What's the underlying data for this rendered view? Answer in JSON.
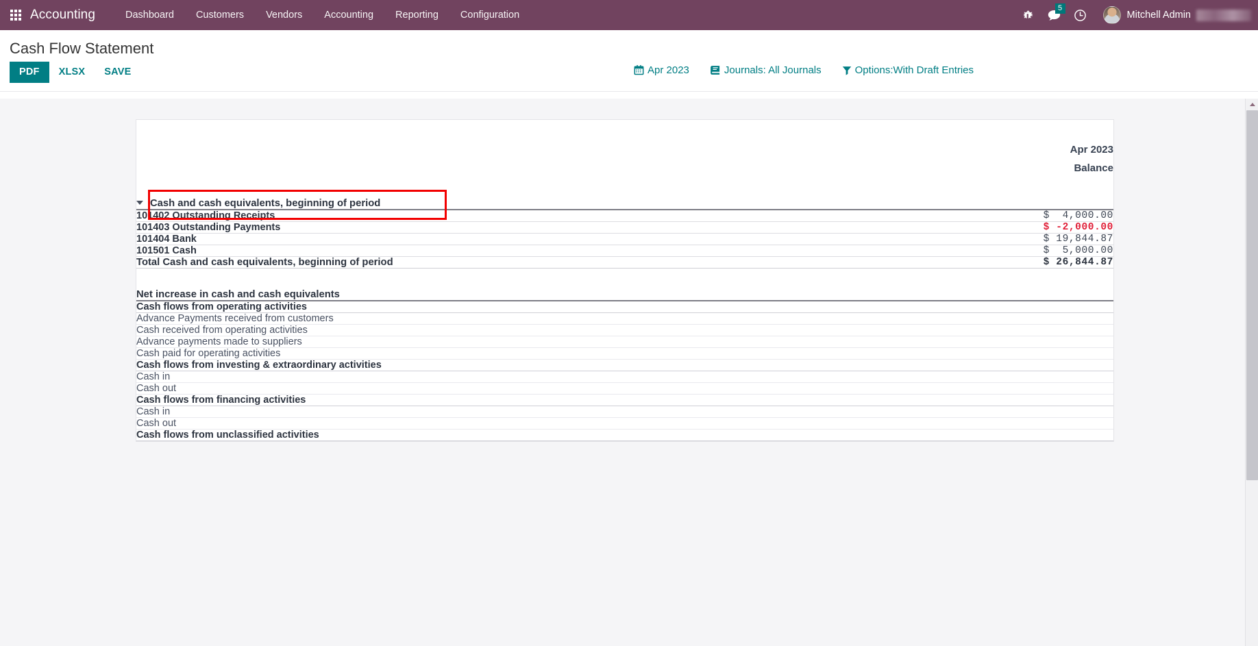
{
  "navbar": {
    "apps_icon": "apps-grid-icon",
    "brand": "Accounting",
    "menu": [
      {
        "label": "Dashboard"
      },
      {
        "label": "Customers"
      },
      {
        "label": "Vendors"
      },
      {
        "label": "Accounting"
      },
      {
        "label": "Reporting"
      },
      {
        "label": "Configuration"
      }
    ],
    "icons": [
      {
        "name": "bug-icon"
      },
      {
        "name": "messages-icon",
        "badge": "5"
      },
      {
        "name": "activities-clock-icon"
      }
    ],
    "user": {
      "name": "Mitchell Admin"
    },
    "accent_color": "#71435F",
    "badge_color": "#00787A"
  },
  "control_panel": {
    "title": "Cash Flow Statement",
    "buttons": [
      {
        "name": "pdf",
        "label": "PDF",
        "style": "primary"
      },
      {
        "name": "xlsx",
        "label": "XLSX",
        "style": "link"
      },
      {
        "name": "save",
        "label": "SAVE",
        "style": "link"
      }
    ],
    "filters": [
      {
        "name": "date-filter",
        "icon": "calendar-icon",
        "label": "Apr 2023"
      },
      {
        "name": "journals-filter",
        "icon": "book-icon",
        "label": "Journals: All Journals"
      },
      {
        "name": "options-filter",
        "icon": "funnel-icon",
        "label": "Options:With Draft Entries"
      }
    ],
    "accent_color": "#017e84"
  },
  "report": {
    "column_header": {
      "period": "Apr 2023",
      "measure": "Balance"
    },
    "highlight_color": "#f20000",
    "negative_color": "#e01e37",
    "rows": [
      {
        "id": "cash-begin",
        "label": "Cash and cash equivalents, beginning of period",
        "value": "",
        "level": 0,
        "type": "section",
        "caret": true,
        "highlighted": true
      },
      {
        "id": "acc-101402",
        "label": "101402 Outstanding Receipts",
        "value": "$  4,000.00",
        "level": 1,
        "type": "account"
      },
      {
        "id": "acc-101403",
        "label": "101403 Outstanding Payments",
        "value": "$ -2,000.00",
        "level": 1,
        "type": "account",
        "negative": true
      },
      {
        "id": "acc-101404",
        "label": "101404 Bank",
        "value": "$ 19,844.87",
        "level": 1,
        "type": "account"
      },
      {
        "id": "acc-101501",
        "label": "101501 Cash",
        "value": "$  5,000.00",
        "level": 1,
        "type": "account"
      },
      {
        "id": "total-cash-begin",
        "label": "Total Cash and cash equivalents, beginning of period",
        "value": "$ 26,844.87",
        "level": 0,
        "type": "total"
      },
      {
        "id": "net-increase",
        "label": "Net increase in cash and cash equivalents",
        "value": "",
        "level": 0,
        "type": "section"
      },
      {
        "id": "cf-operating",
        "label": "Cash flows from operating activities",
        "value": "",
        "level": 1,
        "type": "subsection"
      },
      {
        "id": "adv-pay-received",
        "label": "Advance Payments received from customers",
        "value": "",
        "level": 2,
        "type": "leaf"
      },
      {
        "id": "cash-received-op",
        "label": "Cash received from operating activities",
        "value": "",
        "level": 2,
        "type": "leaf"
      },
      {
        "id": "adv-pay-suppliers",
        "label": "Advance payments made to suppliers",
        "value": "",
        "level": 2,
        "type": "leaf"
      },
      {
        "id": "cash-paid-op",
        "label": "Cash paid for operating activities",
        "value": "",
        "level": 2,
        "type": "leaf"
      },
      {
        "id": "cf-investing",
        "label": "Cash flows from investing & extraordinary activities",
        "value": "",
        "level": 1,
        "type": "subsection"
      },
      {
        "id": "inv-cash-in",
        "label": "Cash in",
        "value": "",
        "level": 2,
        "type": "leaf"
      },
      {
        "id": "inv-cash-out",
        "label": "Cash out",
        "value": "",
        "level": 2,
        "type": "leaf"
      },
      {
        "id": "cf-financing",
        "label": "Cash flows from financing activities",
        "value": "",
        "level": 1,
        "type": "subsection"
      },
      {
        "id": "fin-cash-in",
        "label": "Cash in",
        "value": "",
        "level": 2,
        "type": "leaf"
      },
      {
        "id": "fin-cash-out",
        "label": "Cash out",
        "value": "",
        "level": 2,
        "type": "leaf"
      },
      {
        "id": "cf-unclassified",
        "label": "Cash flows from unclassified activities",
        "value": "",
        "level": 1,
        "type": "subsection"
      }
    ]
  }
}
